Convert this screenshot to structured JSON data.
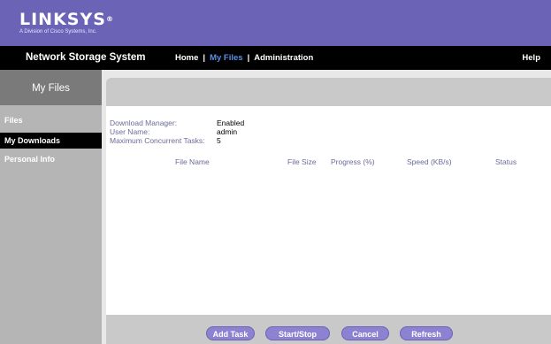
{
  "brand": {
    "name": "LINKSYS",
    "tagline": "A Division of Cisco Systems, Inc."
  },
  "nav": {
    "product_title": "Network Storage System",
    "links": [
      {
        "label": "Home",
        "active": false
      },
      {
        "label": "My Files",
        "active": true
      },
      {
        "label": "Administration",
        "active": false
      }
    ],
    "separator": "|",
    "help": "Help"
  },
  "sidebar": {
    "heading": "My Files",
    "items": [
      {
        "label": "Files",
        "active": false
      },
      {
        "label": "My Downloads",
        "active": true
      },
      {
        "label": "Personal Info",
        "active": false
      }
    ]
  },
  "download_manager": {
    "status_label": "Download Manager:",
    "status_value": "Enabled",
    "user_label": "User Name:",
    "user_value": "admin",
    "max_tasks_label": "Maximum Concurrent Tasks:",
    "max_tasks_value": "5"
  },
  "table": {
    "columns": [
      "File Name",
      "File Size",
      "Progress (%)",
      "Speed (KB/s)",
      "Status"
    ],
    "rows": []
  },
  "actions": {
    "add_task": "Add Task",
    "start_stop": "Start/Stop",
    "cancel": "Cancel",
    "refresh": "Refresh"
  },
  "colors": {
    "brand_purple": "#6b63b5",
    "active_link": "#5a8fe3",
    "button": "#8b83d1"
  }
}
